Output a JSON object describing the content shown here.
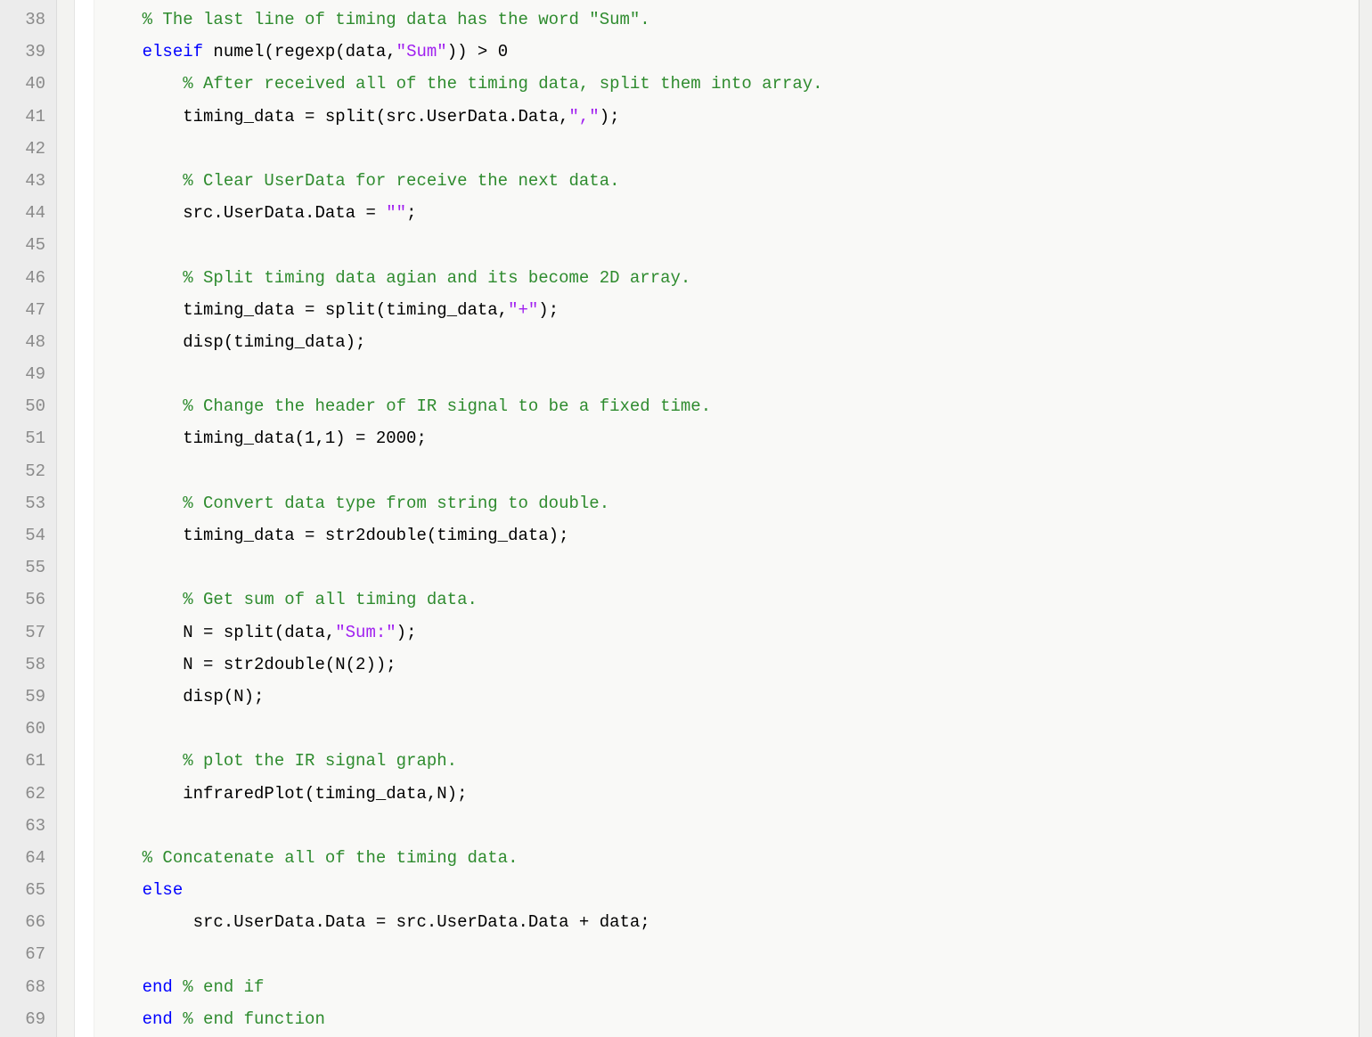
{
  "editor": {
    "first_line_number": 38,
    "lines": [
      {
        "n": 38,
        "indent": 1,
        "tokens": [
          {
            "cls": "tok-comment",
            "t": "% The last line of timing data has the word \"Sum\"."
          }
        ]
      },
      {
        "n": 39,
        "indent": 1,
        "tokens": [
          {
            "cls": "tok-keyword",
            "t": "elseif"
          },
          {
            "cls": "tok-default",
            "t": " numel(regexp(data,"
          },
          {
            "cls": "tok-string",
            "t": "\"Sum\""
          },
          {
            "cls": "tok-default",
            "t": ")) > 0"
          }
        ]
      },
      {
        "n": 40,
        "indent": 2,
        "tokens": [
          {
            "cls": "tok-comment",
            "t": "% After received all of the timing data, split them into array."
          }
        ]
      },
      {
        "n": 41,
        "indent": 2,
        "tokens": [
          {
            "cls": "tok-default",
            "t": "timing_data = split(src.UserData.Data,"
          },
          {
            "cls": "tok-string",
            "t": "\",\""
          },
          {
            "cls": "tok-default",
            "t": ");"
          }
        ]
      },
      {
        "n": 42,
        "indent": 0,
        "tokens": []
      },
      {
        "n": 43,
        "indent": 2,
        "tokens": [
          {
            "cls": "tok-comment",
            "t": "% Clear UserData for receive the next data."
          }
        ]
      },
      {
        "n": 44,
        "indent": 2,
        "tokens": [
          {
            "cls": "tok-default",
            "t": "src.UserData.Data = "
          },
          {
            "cls": "tok-string",
            "t": "\"\""
          },
          {
            "cls": "tok-default",
            "t": ";"
          }
        ]
      },
      {
        "n": 45,
        "indent": 0,
        "tokens": []
      },
      {
        "n": 46,
        "indent": 2,
        "tokens": [
          {
            "cls": "tok-comment",
            "t": "% Split timing data agian and its become 2D array."
          }
        ]
      },
      {
        "n": 47,
        "indent": 2,
        "tokens": [
          {
            "cls": "tok-default",
            "t": "timing_data = split(timing_data,"
          },
          {
            "cls": "tok-string",
            "t": "\"+\""
          },
          {
            "cls": "tok-default",
            "t": ");"
          }
        ]
      },
      {
        "n": 48,
        "indent": 2,
        "tokens": [
          {
            "cls": "tok-default",
            "t": "disp(timing_data);"
          }
        ]
      },
      {
        "n": 49,
        "indent": 0,
        "tokens": []
      },
      {
        "n": 50,
        "indent": 2,
        "tokens": [
          {
            "cls": "tok-comment",
            "t": "% Change the header of IR signal to be a fixed time."
          }
        ]
      },
      {
        "n": 51,
        "indent": 2,
        "tokens": [
          {
            "cls": "tok-default",
            "t": "timing_data(1,1) = 2000;"
          }
        ]
      },
      {
        "n": 52,
        "indent": 0,
        "tokens": []
      },
      {
        "n": 53,
        "indent": 2,
        "tokens": [
          {
            "cls": "tok-comment",
            "t": "% Convert data type from string to double."
          }
        ]
      },
      {
        "n": 54,
        "indent": 2,
        "tokens": [
          {
            "cls": "tok-default",
            "t": "timing_data = str2double(timing_data);"
          }
        ]
      },
      {
        "n": 55,
        "indent": 0,
        "tokens": []
      },
      {
        "n": 56,
        "indent": 2,
        "tokens": [
          {
            "cls": "tok-comment",
            "t": "% Get sum of all timing data."
          }
        ]
      },
      {
        "n": 57,
        "indent": 2,
        "tokens": [
          {
            "cls": "tok-default",
            "t": "N = split(data,"
          },
          {
            "cls": "tok-string",
            "t": "\"Sum:\""
          },
          {
            "cls": "tok-default",
            "t": ");"
          }
        ]
      },
      {
        "n": 58,
        "indent": 2,
        "tokens": [
          {
            "cls": "tok-default",
            "t": "N = str2double(N(2));"
          }
        ]
      },
      {
        "n": 59,
        "indent": 2,
        "tokens": [
          {
            "cls": "tok-default",
            "t": "disp(N);"
          }
        ]
      },
      {
        "n": 60,
        "indent": 0,
        "tokens": []
      },
      {
        "n": 61,
        "indent": 2,
        "tokens": [
          {
            "cls": "tok-comment",
            "t": "% plot the IR signal graph."
          }
        ]
      },
      {
        "n": 62,
        "indent": 2,
        "tokens": [
          {
            "cls": "tok-default",
            "t": "infraredPlot(timing_data,N);"
          }
        ]
      },
      {
        "n": 63,
        "indent": 0,
        "tokens": []
      },
      {
        "n": 64,
        "indent": 1,
        "tokens": [
          {
            "cls": "tok-comment",
            "t": "% Concatenate all of the timing data."
          }
        ]
      },
      {
        "n": 65,
        "indent": 1,
        "tokens": [
          {
            "cls": "tok-keyword",
            "t": "else"
          }
        ]
      },
      {
        "n": 66,
        "indent": 2,
        "tokens": [
          {
            "cls": "tok-default",
            "t": " src.UserData.Data = src.UserData.Data + data;"
          }
        ]
      },
      {
        "n": 67,
        "indent": 0,
        "tokens": []
      },
      {
        "n": 68,
        "indent": 1,
        "tokens": [
          {
            "cls": "tok-keyword",
            "t": "end"
          },
          {
            "cls": "tok-default",
            "t": " "
          },
          {
            "cls": "tok-comment",
            "t": "% end if"
          }
        ]
      },
      {
        "n": 69,
        "indent": 1,
        "tokens": [
          {
            "cls": "tok-keyword",
            "t": "end"
          },
          {
            "cls": "tok-default",
            "t": " "
          },
          {
            "cls": "tok-comment",
            "t": "% end function"
          }
        ]
      }
    ]
  }
}
